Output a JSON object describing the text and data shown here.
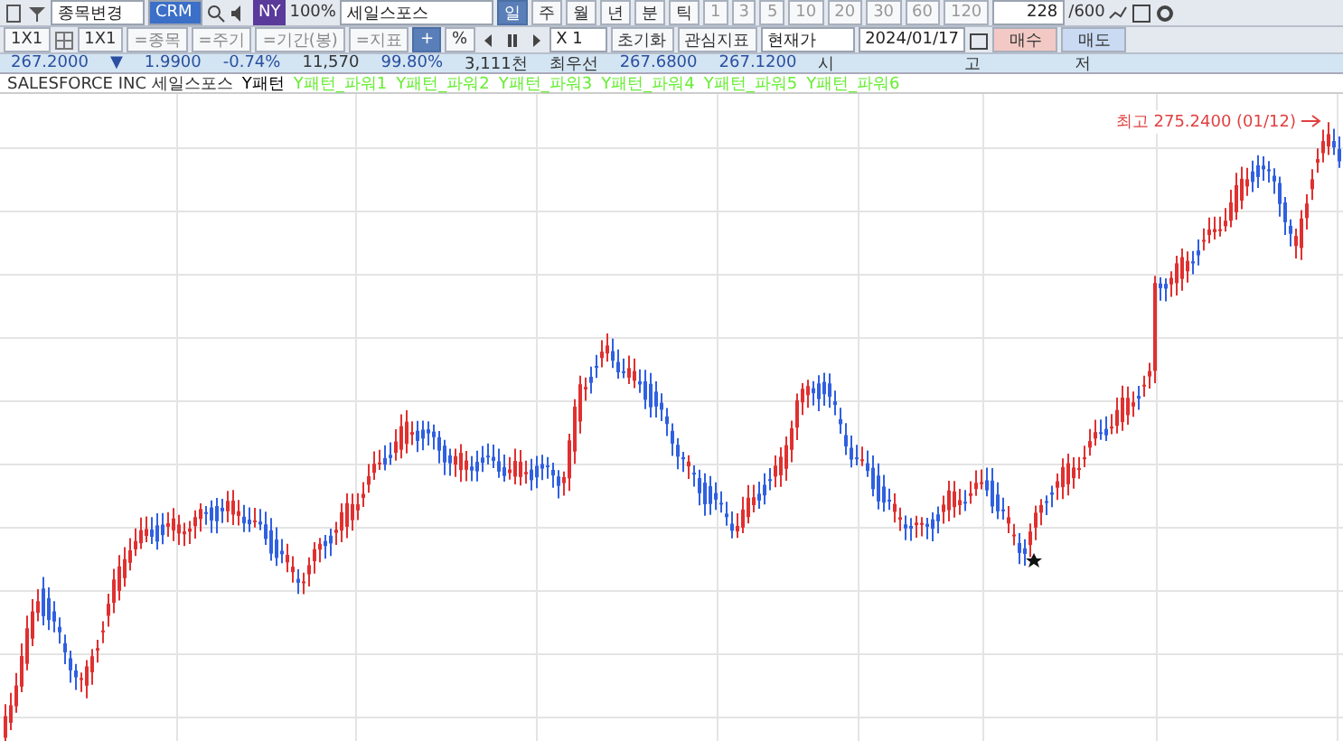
{
  "toolbar1": {
    "stock_change": "종목변경",
    "code": "CRM",
    "badge": "NY",
    "zoom": "100%",
    "name": "세일스포스",
    "periods": [
      {
        "label": "일",
        "selected": true
      },
      {
        "label": "주",
        "selected": false
      },
      {
        "label": "월",
        "selected": false
      },
      {
        "label": "년",
        "selected": false
      },
      {
        "label": "분",
        "selected": false
      },
      {
        "label": "틱",
        "selected": false
      }
    ],
    "intervals": [
      "1",
      "3",
      "5",
      "10",
      "20",
      "30",
      "60",
      "120"
    ],
    "count": "228",
    "count_max": "/600"
  },
  "toolbar2": {
    "layout_a": "1X1",
    "layout_b": "1X1",
    "eq_buttons": [
      "=종목",
      "=주기",
      "=기간(봉)",
      "=지표"
    ],
    "toggles": [
      {
        "label": "+",
        "selected": true
      },
      {
        "label": "%",
        "selected": false
      }
    ],
    "multiplier": "X 1",
    "buttons": [
      "초기화",
      "관심지표"
    ],
    "price_type": "현재가",
    "date": "2024/01/17",
    "buy": "매수",
    "sell": "매도"
  },
  "quote": {
    "price": "267.2000",
    "direction": "▼",
    "change": "1.9900",
    "change_rate": "-0.74%",
    "volume": "11,570",
    "ratio": "99.80%",
    "amount": "3,111천",
    "best_label": "최우선",
    "ask": "267.6800",
    "bid": "267.1200",
    "open_label": "시",
    "high_label": "고",
    "low_label": "저"
  },
  "legend": [
    {
      "label": "SALESFORCE INC  세일스포스",
      "color": "#333333"
    },
    {
      "label": "Y패턴",
      "color": "#000000"
    },
    {
      "label": "Y패턴_파워1",
      "color": "#66ee33"
    },
    {
      "label": "Y패턴_파워2",
      "color": "#66ee33"
    },
    {
      "label": "Y패턴_파워3",
      "color": "#66ee33"
    },
    {
      "label": "Y패턴_파워4",
      "color": "#66ee33"
    },
    {
      "label": "Y패턴_파워5",
      "color": "#66ee33"
    },
    {
      "label": "Y패턴_파워6",
      "color": "#66ee33"
    }
  ],
  "chart": {
    "high_note": "최고 275.2400 (01/12)"
  }
}
